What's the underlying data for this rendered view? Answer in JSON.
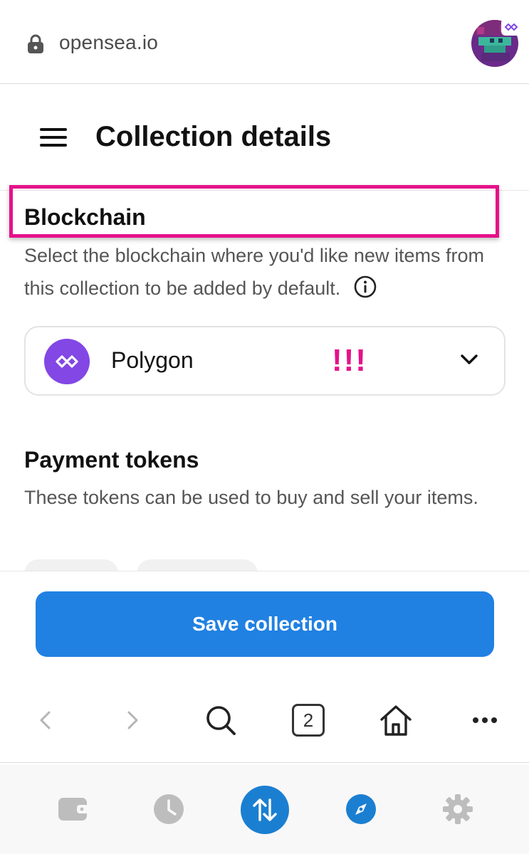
{
  "browser": {
    "url": "opensea.io",
    "tab_count": "2"
  },
  "page": {
    "title": "Collection details"
  },
  "blockchain": {
    "title": "Blockchain",
    "description": "Select the blockchain where you'd like new items from this collection to be added by default.",
    "selected": "Polygon",
    "annotation": "!!!"
  },
  "payment_tokens": {
    "title": "Payment tokens",
    "description": "These tokens can be used to buy and sell your items."
  },
  "actions": {
    "save_label": "Save collection"
  },
  "icons": {
    "lock": "lock-icon",
    "menu": "hamburger-menu-icon",
    "info": "info-icon",
    "chain": "polygon-logo-icon",
    "chevron": "chevron-down-icon",
    "back": "back-arrow-icon",
    "forward": "forward-arrow-icon",
    "search": "search-icon",
    "home": "home-icon",
    "more": "more-dots-icon",
    "wallet": "wallet-icon",
    "history": "clock-icon",
    "swap": "swap-icon",
    "browser": "compass-icon",
    "settings": "gear-icon"
  },
  "colors": {
    "accent_blue": "#2081e2",
    "polygon_purple": "#8247e5",
    "highlight_pink": "#e5118a"
  }
}
